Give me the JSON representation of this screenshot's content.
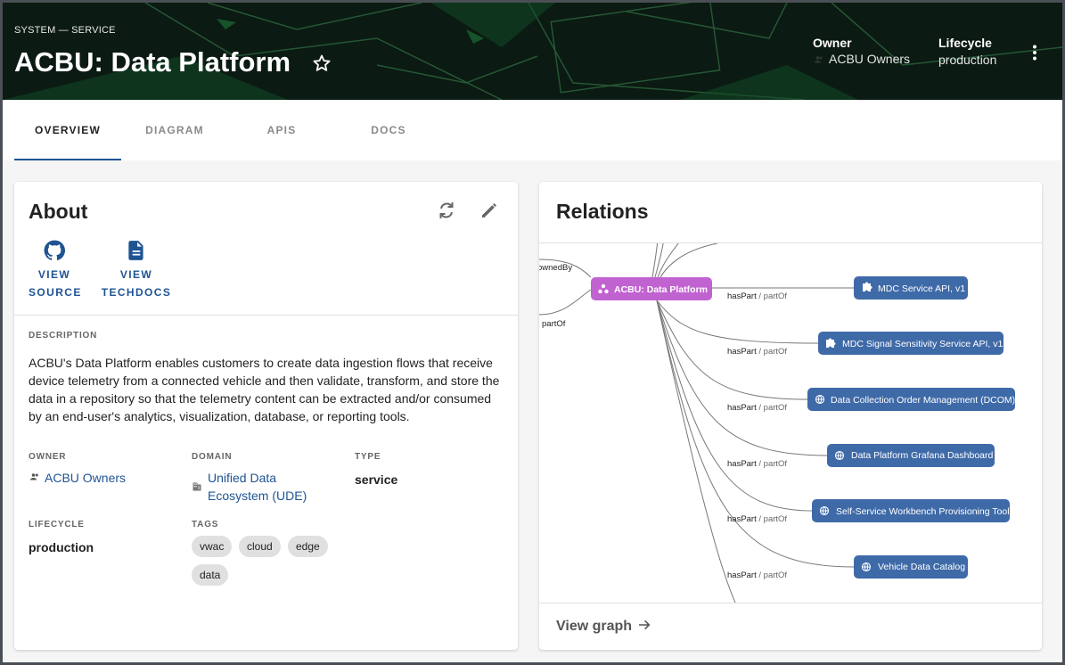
{
  "header": {
    "kind": "SYSTEM — SERVICE",
    "title": "ACBU: Data Platform",
    "owner_label": "Owner",
    "owner_value": "ACBU Owners",
    "lifecycle_label": "Lifecycle",
    "lifecycle_value": "production"
  },
  "tabs": [
    {
      "label": "OVERVIEW",
      "active": true
    },
    {
      "label": "DIAGRAM"
    },
    {
      "label": "APIS"
    },
    {
      "label": "DOCS"
    }
  ],
  "about": {
    "title": "About",
    "links": [
      {
        "line1": "VIEW",
        "line2": "SOURCE",
        "icon": "github-icon"
      },
      {
        "line1": "VIEW",
        "line2": "TECHDOCS",
        "icon": "document-icon"
      }
    ],
    "description_label": "DESCRIPTION",
    "description": "ACBU's Data Platform enables customers to create data ingestion flows that receive device telemetry from a connected vehicle and then validate, transform, and store the data in a repository so that the telemetry content can be extracted and/or consumed by an end-user's analytics, visualization, database, or reporting tools.",
    "owner_label": "OWNER",
    "owner_value": "ACBU Owners",
    "domain_label": "DOMAIN",
    "domain_line1": "Unified Data",
    "domain_line2": "Ecosystem (UDE)",
    "type_label": "TYPE",
    "type_value": "service",
    "lifecycle_label": "LIFECYCLE",
    "lifecycle_value": "production",
    "tags_label": "TAGS",
    "tags": [
      "vwac",
      "cloud",
      "edge",
      "data"
    ]
  },
  "relations": {
    "title": "Relations",
    "center_node": "ACBU: Data Platform",
    "left_edge_labels": [
      "ownedBy",
      "partOf"
    ],
    "edge_label_strong": "hasPart",
    "edge_label_muted": "/ partOf",
    "nodes": [
      {
        "label": "MDC Service API, v1",
        "icon": "puzzle-icon"
      },
      {
        "label": "MDC Signal Sensitivity Service API, v1",
        "icon": "puzzle-icon"
      },
      {
        "label": "Data Collection Order Management (DCOM)",
        "icon": "globe-icon"
      },
      {
        "label": "Data Platform Grafana Dashboard",
        "icon": "globe-icon"
      },
      {
        "label": "Self-Service Workbench Provisioning Tool",
        "icon": "globe-icon"
      },
      {
        "label": "Vehicle Data Catalog",
        "icon": "globe-icon"
      }
    ],
    "view_graph": "View graph"
  },
  "colors": {
    "accent": "#1f5493",
    "system_node": "#c162d1",
    "component_node": "#3f6aa8",
    "header_bg": "#0b1a12"
  }
}
